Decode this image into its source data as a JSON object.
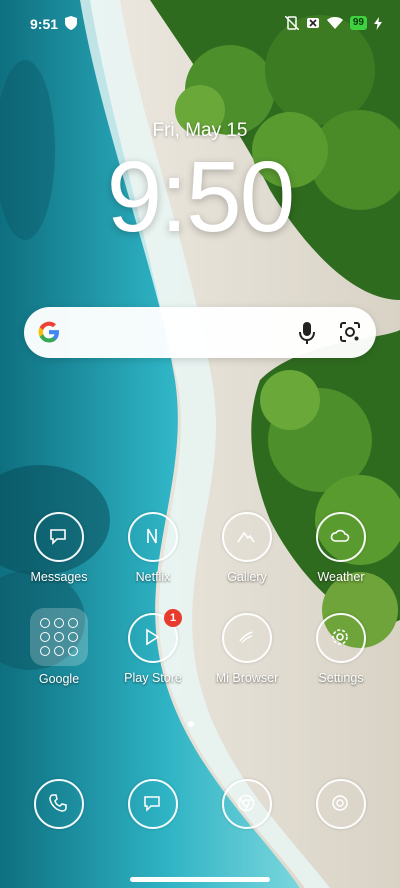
{
  "status": {
    "time": "9:51",
    "battery": "99"
  },
  "lockscreen": {
    "date": "Fri, May 15",
    "clock": "9:50"
  },
  "apps": [
    {
      "label": "Messages",
      "icon": "chat-bubble-icon"
    },
    {
      "label": "Netflix",
      "icon": "netflix-n-icon"
    },
    {
      "label": "Gallery",
      "icon": "mountains-icon"
    },
    {
      "label": "Weather",
      "icon": "cloud-icon"
    },
    {
      "label": "Google",
      "icon": "folder-grid-icon"
    },
    {
      "label": "Play Store",
      "icon": "play-triangle-icon",
      "badge": "1"
    },
    {
      "label": "Mi Browser",
      "icon": "compass-icon"
    },
    {
      "label": "Settings",
      "icon": "gear-icon"
    }
  ],
  "dock": [
    {
      "icon": "phone-icon"
    },
    {
      "icon": "chat-icon"
    },
    {
      "icon": "chrome-icon"
    },
    {
      "icon": "camera-icon"
    }
  ],
  "colors": {
    "sea": "#2aa6b8",
    "sand": "#ece7dc",
    "palm": "#3f7d25",
    "badge": "#e83b2e"
  }
}
